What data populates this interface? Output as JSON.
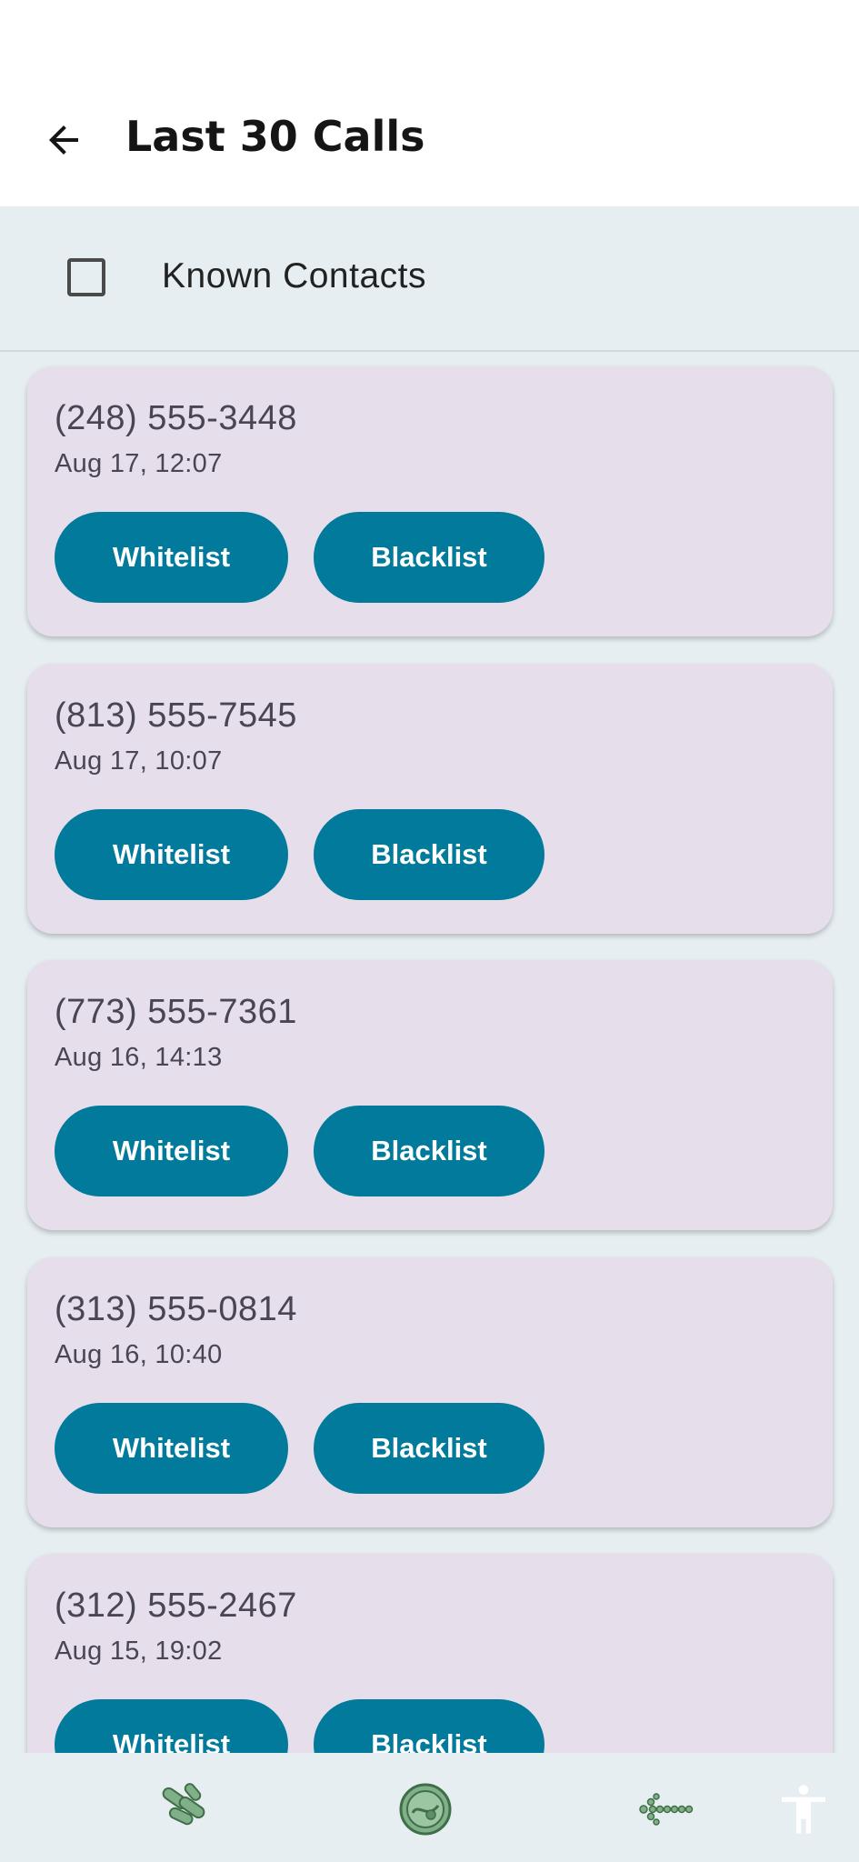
{
  "app": {
    "title": "Last 30 Calls"
  },
  "filter": {
    "label": "Known Contacts",
    "checked": false
  },
  "calls": [
    {
      "phone": "(248) 555-3448",
      "date": "Aug 17, 12:07",
      "whitelist_label": "Whitelist",
      "blacklist_label": "Blacklist"
    },
    {
      "phone": "(813) 555-7545",
      "date": "Aug 17, 10:07",
      "whitelist_label": "Whitelist",
      "blacklist_label": "Blacklist"
    },
    {
      "phone": "(773) 555-7361",
      "date": "Aug 16, 14:13",
      "whitelist_label": "Whitelist",
      "blacklist_label": "Blacklist"
    },
    {
      "phone": "(313) 555-0814",
      "date": "Aug 16, 10:40",
      "whitelist_label": "Whitelist",
      "blacklist_label": "Blacklist"
    },
    {
      "phone": "(312) 555-2467",
      "date": "Aug 15, 19:02",
      "whitelist_label": "Whitelist",
      "blacklist_label": "Blacklist"
    }
  ],
  "bottom_nav": [
    {
      "icon": "bacteria-icon"
    },
    {
      "icon": "cell-icon"
    },
    {
      "icon": "dna-arrow-icon"
    },
    {
      "icon": "accessibility-icon"
    }
  ],
  "colors": {
    "accent": "#017a9b",
    "card": "#e6dfeb",
    "background": "#e6eef1",
    "nav_icon": "#6aa074"
  }
}
